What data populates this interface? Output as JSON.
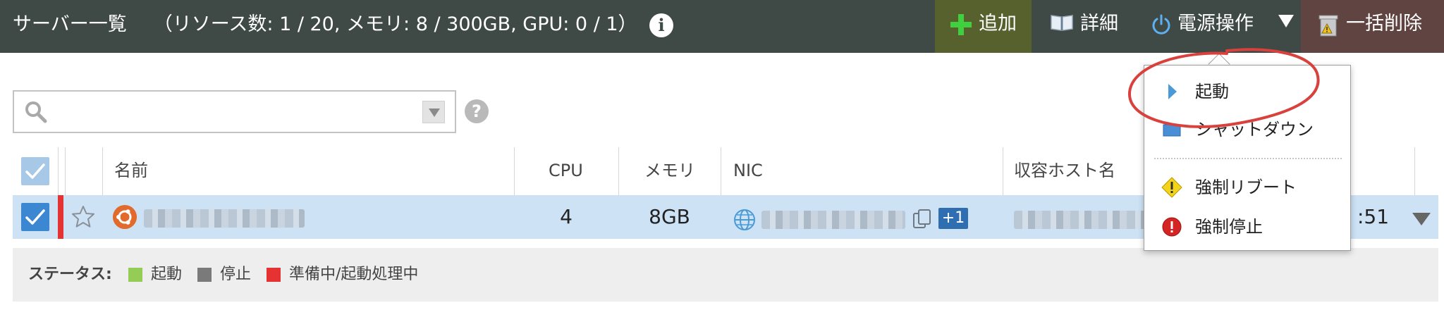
{
  "header": {
    "title": "サーバー一覧",
    "resources": "（リソース数: 1 / 20, メモリ: 8 / 300GB, GPU: 0 / 1）",
    "info_label": "i"
  },
  "toolbar": {
    "add_label": "追加",
    "detail_label": "詳細",
    "power_label": "電源操作",
    "bulk_delete_label": "一括削除"
  },
  "search": {
    "value": "",
    "placeholder": "",
    "help_label": "?"
  },
  "table": {
    "columns": [
      "名前",
      "CPU",
      "メモリ",
      "NIC",
      "収容ホスト名"
    ],
    "rows": [
      {
        "cpu": "4",
        "memory": "8GB",
        "nic_extra": "+1",
        "time_suffix": ":51",
        "status": "準備中/起動処理中"
      }
    ]
  },
  "legend": {
    "label": "ステータス:",
    "items": [
      {
        "label": "起動",
        "color": "#95cc55"
      },
      {
        "label": "停止",
        "color": "#7a7a7a"
      },
      {
        "label": "準備中/起動処理中",
        "color": "#e53232"
      }
    ]
  },
  "power_menu": {
    "items": [
      {
        "label": "起動",
        "icon": "play-icon"
      },
      {
        "label": "シャットダウン",
        "icon": "shutdown-icon"
      },
      {
        "label": "強制リブート",
        "icon": "warning-icon"
      },
      {
        "label": "強制停止",
        "icon": "stop-icon"
      }
    ]
  },
  "colors": {
    "header_bg": "#3f4946",
    "add_bg": "#56612e",
    "delete_bg": "#5f4441",
    "row_selected": "#cde2f5",
    "checkbox": "#3b87d2",
    "annotation": "#d9413d"
  }
}
